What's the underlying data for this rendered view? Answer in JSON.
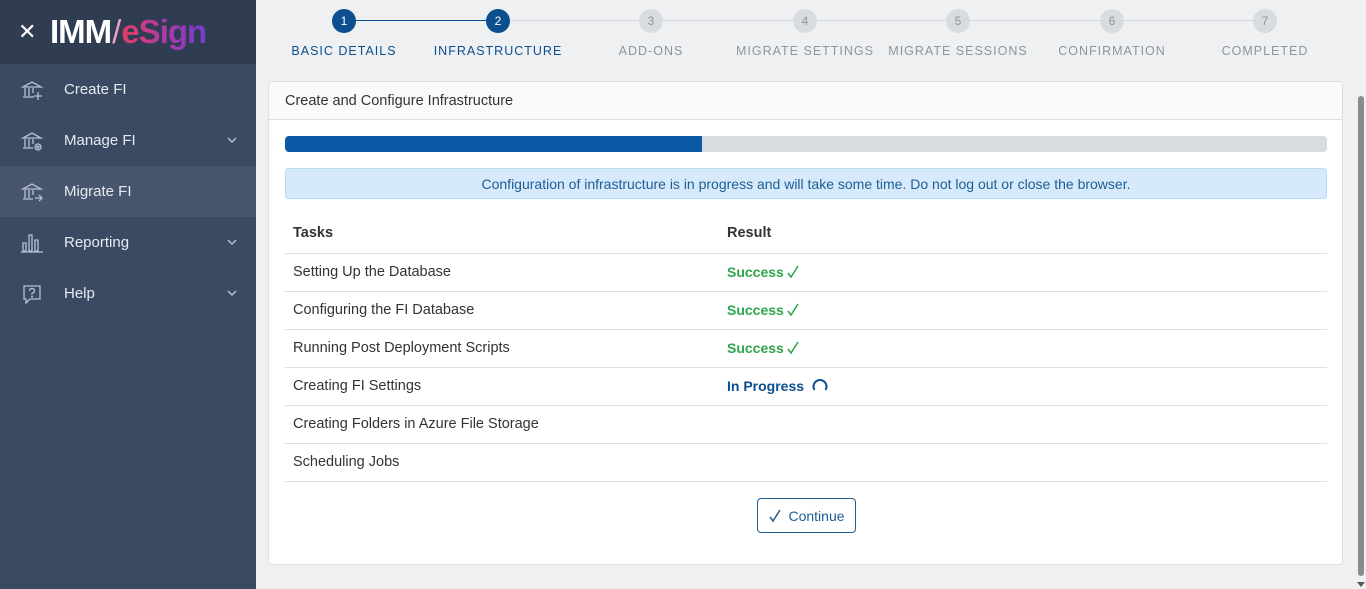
{
  "brand": {
    "logo_prefix": "IMM",
    "logo_slash": "/",
    "logo_suffix": "eSign",
    "close_icon": "close-icon"
  },
  "sidebar": {
    "items": [
      {
        "label": "Create FI",
        "icon": "bank-add-icon",
        "chevron": false,
        "active": false
      },
      {
        "label": "Manage FI",
        "icon": "bank-gear-icon",
        "chevron": true,
        "active": false
      },
      {
        "label": "Migrate FI",
        "icon": "bank-migrate-icon",
        "chevron": false,
        "active": true
      },
      {
        "label": "Reporting",
        "icon": "bar-chart-icon",
        "chevron": true,
        "active": false
      },
      {
        "label": "Help",
        "icon": "help-icon",
        "chevron": true,
        "active": false
      }
    ]
  },
  "stepper": {
    "steps": [
      {
        "number": "1",
        "label": "BASIC DETAILS",
        "state": "done"
      },
      {
        "number": "2",
        "label": "INFRASTRUCTURE",
        "state": "done"
      },
      {
        "number": "3",
        "label": "ADD-ONS",
        "state": "todo"
      },
      {
        "number": "4",
        "label": "MIGRATE SETTINGS",
        "state": "todo"
      },
      {
        "number": "5",
        "label": "MIGRATE SESSIONS",
        "state": "todo"
      },
      {
        "number": "6",
        "label": "CONFIRMATION",
        "state": "todo"
      },
      {
        "number": "7",
        "label": "COMPLETED",
        "state": "todo"
      }
    ]
  },
  "card": {
    "title": "Create and Configure Infrastructure",
    "progress_fraction": 0.4,
    "alert_text": "Configuration of infrastructure is in progress and will take some time. Do not log out or close the browser.",
    "table": {
      "headers": [
        "Tasks",
        "Result"
      ],
      "rows": [
        {
          "task": "Setting Up the Database",
          "result": "Success",
          "status": "success"
        },
        {
          "task": "Configuring the FI Database",
          "result": "Success",
          "status": "success"
        },
        {
          "task": "Running Post Deployment Scripts",
          "result": "Success",
          "status": "success"
        },
        {
          "task": "Creating FI Settings",
          "result": "In Progress",
          "status": "progress"
        },
        {
          "task": "Creating Folders in Azure File Storage",
          "result": "",
          "status": "none"
        },
        {
          "task": "Scheduling Jobs",
          "result": "",
          "status": "none"
        }
      ]
    },
    "continue_label": "Continue"
  },
  "colors": {
    "sidebar_bg": "#3b4a63",
    "primary": "#0b4f8e",
    "success": "#2da44e"
  }
}
